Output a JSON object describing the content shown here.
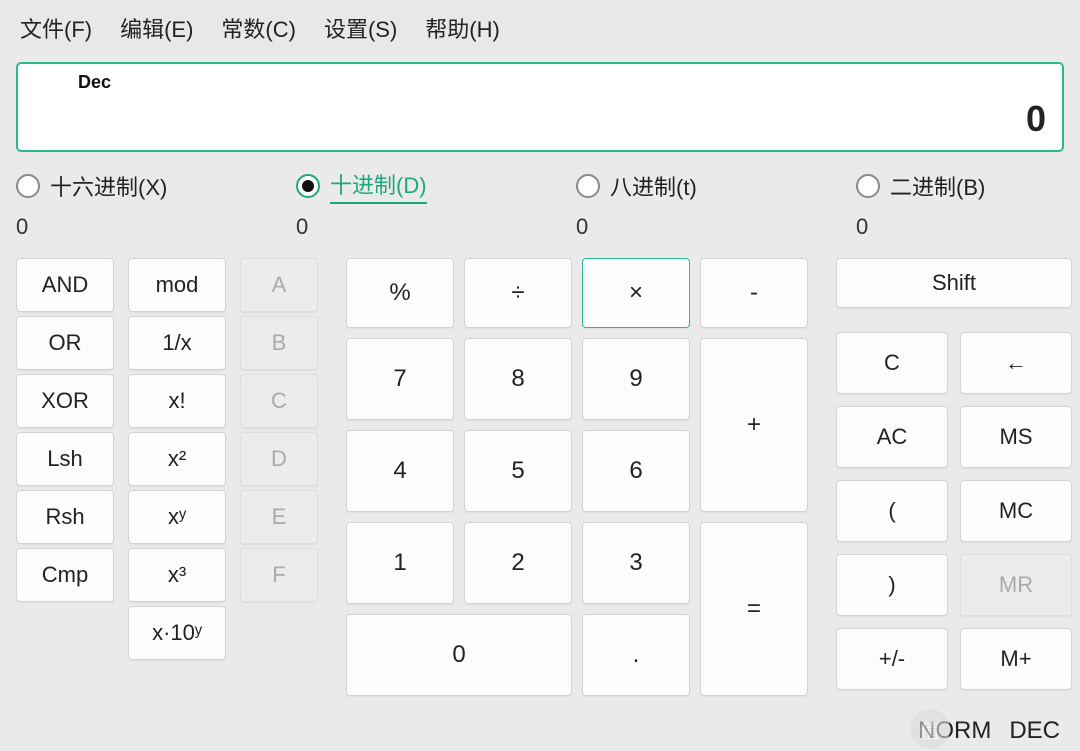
{
  "menu": {
    "file": "文件(F)",
    "edit": "编辑(E)",
    "const": "常数(C)",
    "settings": "设置(S)",
    "help": "帮助(H)"
  },
  "display": {
    "mode_label": "Dec",
    "value": "0"
  },
  "radix": {
    "hex": "十六进制(X)",
    "dec": "十进制(D)",
    "oct": "八进制(t)",
    "bin": "二进制(B)",
    "selected": "dec",
    "hex_val": "0",
    "dec_val": "0",
    "oct_val": "0",
    "bin_val": "0"
  },
  "logic": {
    "and": "AND",
    "or": "OR",
    "xor": "XOR",
    "lsh": "Lsh",
    "rsh": "Rsh",
    "cmp": "Cmp",
    "mod": "mod",
    "inv": "1/x",
    "fact": "x!",
    "sq": "x²",
    "pow": "xʸ",
    "cube": "x³",
    "sci": "x·10ʸ"
  },
  "hex_digits": {
    "a": "A",
    "b": "B",
    "c": "C",
    "d": "D",
    "e": "E",
    "f": "F"
  },
  "ops": {
    "pct": "%",
    "div": "÷",
    "mul": "×",
    "sub": "-",
    "add": "+",
    "eq": "=",
    "d7": "7",
    "d8": "8",
    "d9": "9",
    "d4": "4",
    "d5": "5",
    "d6": "6",
    "d1": "1",
    "d2": "2",
    "d3": "3",
    "d0": "0",
    "dot": "."
  },
  "side": {
    "shift": "Shift",
    "c": "C",
    "back": "←",
    "ac": "AC",
    "ms": "MS",
    "lp": "(",
    "mc": "MC",
    "rp": ")",
    "mr": "MR",
    "pm": "+/-",
    "mplus": "M+"
  },
  "status": {
    "norm": "NORM",
    "base": "DEC"
  },
  "watermark": "值"
}
